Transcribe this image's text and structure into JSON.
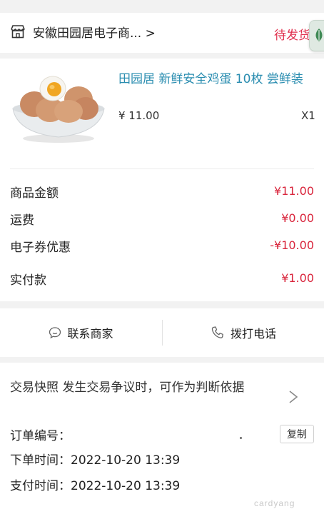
{
  "shop": {
    "name": "安徽田园居电子商... >",
    "status": "待发货"
  },
  "product": {
    "title": "田园居 新鲜安全鸡蛋 10枚 尝鲜装",
    "price": "¥ 11.00",
    "quantity": "X1"
  },
  "amounts": [
    {
      "label": "商品金额",
      "value": "¥11.00"
    },
    {
      "label": "运费",
      "value": "¥0.00"
    },
    {
      "label": "电子券优惠",
      "value": "-¥10.00"
    },
    {
      "label": "实付款",
      "value": "¥1.00"
    }
  ],
  "contact": {
    "merchant_label": "联系商家",
    "call_label": "拨打电话"
  },
  "info": {
    "snapshot_text": "交易快照   发生交易争议时，可作为判断依据",
    "order_no_label": "订单编号：",
    "copy_label": "复制",
    "order_time": "下单时间：2022-10-20 13:39",
    "pay_time": "支付时间：2022-10-20 13:39"
  },
  "watermark": "cardyang",
  "colors": {
    "accent_red": "#e0304e",
    "price_red": "#d9253c",
    "title_blue": "#2a8db0"
  }
}
